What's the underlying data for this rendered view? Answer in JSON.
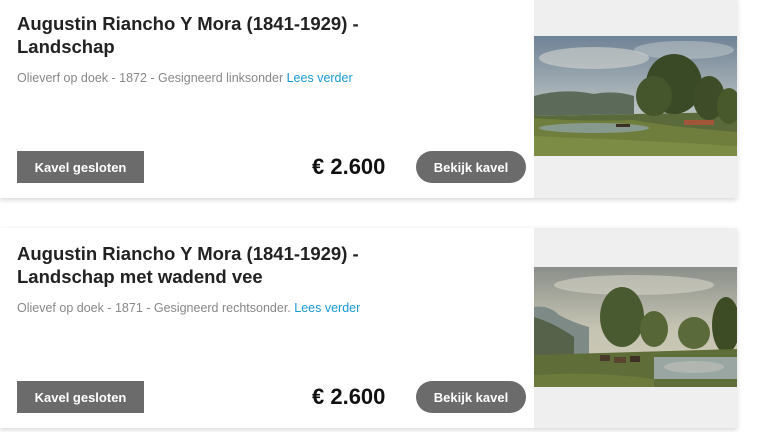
{
  "lots": [
    {
      "title_line1": "Augustin Riancho Y Mora (1841-1929) -",
      "title_line2": "Landschap",
      "description": "Olieverf op doek - 1872 - Gesigneerd linksonder",
      "read_more": "Lees verder",
      "status": "Kavel gesloten",
      "price": "€ 2.600",
      "view_button": "Bekijk kavel"
    },
    {
      "title_line1": "Augustin Riancho Y Mora (1841-1929) -",
      "title_line2": "Landschap met wadend vee",
      "description": "Olievef op doek - 1871 - Gesigneerd rechtsonder.",
      "read_more": "Lees verder",
      "status": "Kavel gesloten",
      "price": "€ 2.600",
      "view_button": "Bekijk kavel"
    }
  ]
}
